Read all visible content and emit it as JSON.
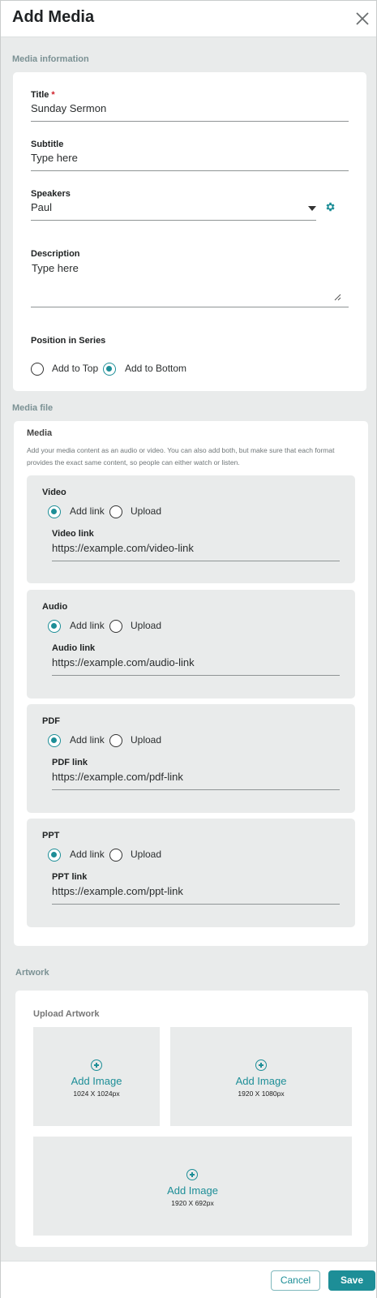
{
  "header": {
    "title": "Add Media"
  },
  "media_information": {
    "section_label": "Media information",
    "title": {
      "label": "Title",
      "required_mark": "*",
      "value": "Sunday Sermon"
    },
    "subtitle": {
      "label": "Subtitle",
      "placeholder": "Type here"
    },
    "speakers": {
      "label": "Speakers",
      "value": "Paul"
    },
    "description": {
      "label": "Description",
      "placeholder": "Type here"
    },
    "position": {
      "label": "Position in Series",
      "options": [
        {
          "label": "Add to Top",
          "selected": false
        },
        {
          "label": "Add to Bottom",
          "selected": true
        }
      ]
    }
  },
  "media_file": {
    "section_label": "Media file",
    "card_title": "Media",
    "hint": "Add your media content as an audio or video. You can also add both, but make sure that each format provides the exact same content, so people can either watch or listen.",
    "option_add_link": "Add link",
    "option_upload": "Upload",
    "items": [
      {
        "title": "Video",
        "link_label": "Video link",
        "link_value": "https://example.com/video-link",
        "selected": "Add link"
      },
      {
        "title": "Audio",
        "link_label": "Audio link",
        "link_value": "https://example.com/audio-link",
        "selected": "Add link"
      },
      {
        "title": "PDF",
        "link_label": "PDF link",
        "link_value": "https://example.com/pdf-link",
        "selected": "Add link"
      },
      {
        "title": "PPT",
        "link_label": "PPT link",
        "link_value": "https://example.com/ppt-link",
        "selected": "Add link"
      }
    ]
  },
  "artwork": {
    "section_label": "Artwork",
    "card_title": "Upload Artwork",
    "add_label": "Add Image",
    "tiles": [
      {
        "size": "1024 X 1024px"
      },
      {
        "size": "1920 X 1080px"
      },
      {
        "size": "1920 X 692px"
      }
    ]
  },
  "footer": {
    "cancel_label": "Cancel",
    "save_label": "Save"
  },
  "colors": {
    "accent": "#1d8e97",
    "required": "#d0212b",
    "background": "#e9ebeb"
  }
}
